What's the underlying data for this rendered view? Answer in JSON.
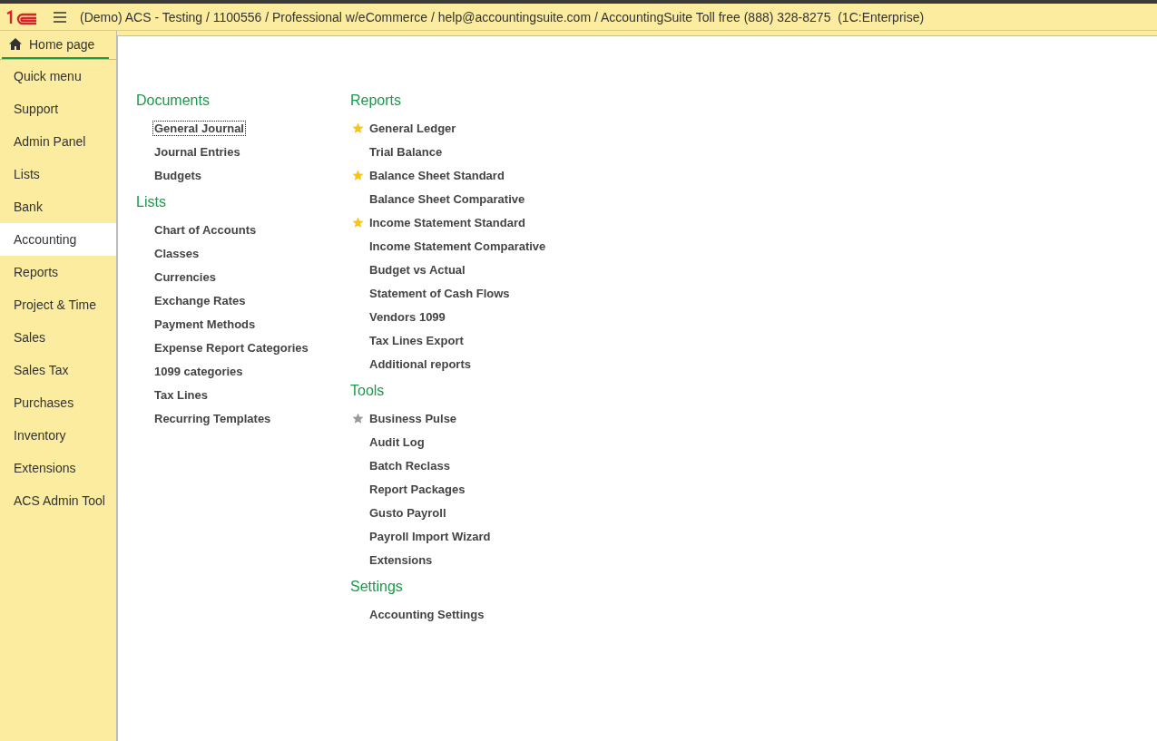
{
  "header": {
    "title": "(Demo) ACS - Testing / 1100556 / Professional w/eCommerce / help@accountingsuite.com / AccountingSuite Toll free (888) 328-8275  (1C:Enterprise)"
  },
  "home_tab": {
    "label": "Home page",
    "selected": true
  },
  "sidebar": {
    "items": [
      {
        "label": "Quick menu",
        "selected": false
      },
      {
        "label": "Support",
        "selected": false
      },
      {
        "label": "Admin Panel",
        "selected": false
      },
      {
        "label": "Lists",
        "selected": false
      },
      {
        "label": "Bank",
        "selected": false
      },
      {
        "label": "Accounting",
        "selected": true
      },
      {
        "label": "Reports",
        "selected": false
      },
      {
        "label": "Project & Time",
        "selected": false
      },
      {
        "label": "Sales",
        "selected": false
      },
      {
        "label": "Sales Tax",
        "selected": false
      },
      {
        "label": "Purchases",
        "selected": false
      },
      {
        "label": "Inventory",
        "selected": false
      },
      {
        "label": "Extensions",
        "selected": false
      },
      {
        "label": "ACS Admin Tool",
        "selected": false
      }
    ]
  },
  "columns": [
    [
      {
        "title": "Documents",
        "items": [
          {
            "label": "General Journal",
            "kind": "plain",
            "focused": true
          },
          {
            "label": "Journal Entries",
            "kind": "plain",
            "focused": false
          },
          {
            "label": "Budgets",
            "kind": "plain",
            "focused": false
          }
        ]
      },
      {
        "title": "Lists",
        "items": [
          {
            "label": "Chart of Accounts",
            "kind": "plain",
            "focused": false
          },
          {
            "label": "Classes",
            "kind": "plain",
            "focused": false
          },
          {
            "label": "Currencies",
            "kind": "plain",
            "focused": false
          },
          {
            "label": "Exchange Rates",
            "kind": "plain",
            "focused": false
          },
          {
            "label": "Payment Methods",
            "kind": "plain",
            "focused": false
          },
          {
            "label": "Expense Report Categories",
            "kind": "plain",
            "focused": false
          },
          {
            "label": "1099 categories",
            "kind": "plain",
            "focused": false
          },
          {
            "label": "Tax Lines",
            "kind": "plain",
            "focused": false
          },
          {
            "label": "Recurring Templates",
            "kind": "plain",
            "focused": false
          }
        ]
      }
    ],
    [
      {
        "title": "Reports",
        "items": [
          {
            "label": "General Ledger",
            "kind": "favorite",
            "focused": false
          },
          {
            "label": "Trial Balance",
            "kind": "plain",
            "focused": false
          },
          {
            "label": "Balance Sheet Standard",
            "kind": "favorite",
            "focused": false
          },
          {
            "label": "Balance Sheet Comparative",
            "kind": "plain",
            "focused": false
          },
          {
            "label": "Income Statement Standard",
            "kind": "favorite",
            "focused": false
          },
          {
            "label": "Income Statement Comparative",
            "kind": "plain",
            "focused": false
          },
          {
            "label": "Budget vs Actual",
            "kind": "plain",
            "focused": false
          },
          {
            "label": "Statement of Cash Flows",
            "kind": "plain",
            "focused": false
          },
          {
            "label": "Vendors 1099",
            "kind": "plain",
            "focused": false
          },
          {
            "label": "Tax Lines Export",
            "kind": "plain",
            "focused": false
          },
          {
            "label": "Additional reports",
            "kind": "plain",
            "focused": false
          }
        ]
      },
      {
        "title": "Tools",
        "items": [
          {
            "label": "Business Pulse",
            "kind": "starred",
            "focused": false
          },
          {
            "label": "Audit Log",
            "kind": "plain",
            "focused": false
          },
          {
            "label": "Batch Reclass",
            "kind": "plain",
            "focused": false
          },
          {
            "label": "Report Packages",
            "kind": "plain",
            "focused": false
          },
          {
            "label": "Gusto Payroll",
            "kind": "plain",
            "focused": false
          },
          {
            "label": "Payroll Import Wizard",
            "kind": "plain",
            "focused": false
          },
          {
            "label": "Extensions",
            "kind": "plain",
            "focused": false
          }
        ]
      },
      {
        "title": "Settings",
        "items": [
          {
            "label": "Accounting Settings",
            "kind": "plain",
            "focused": false
          }
        ]
      }
    ]
  ]
}
